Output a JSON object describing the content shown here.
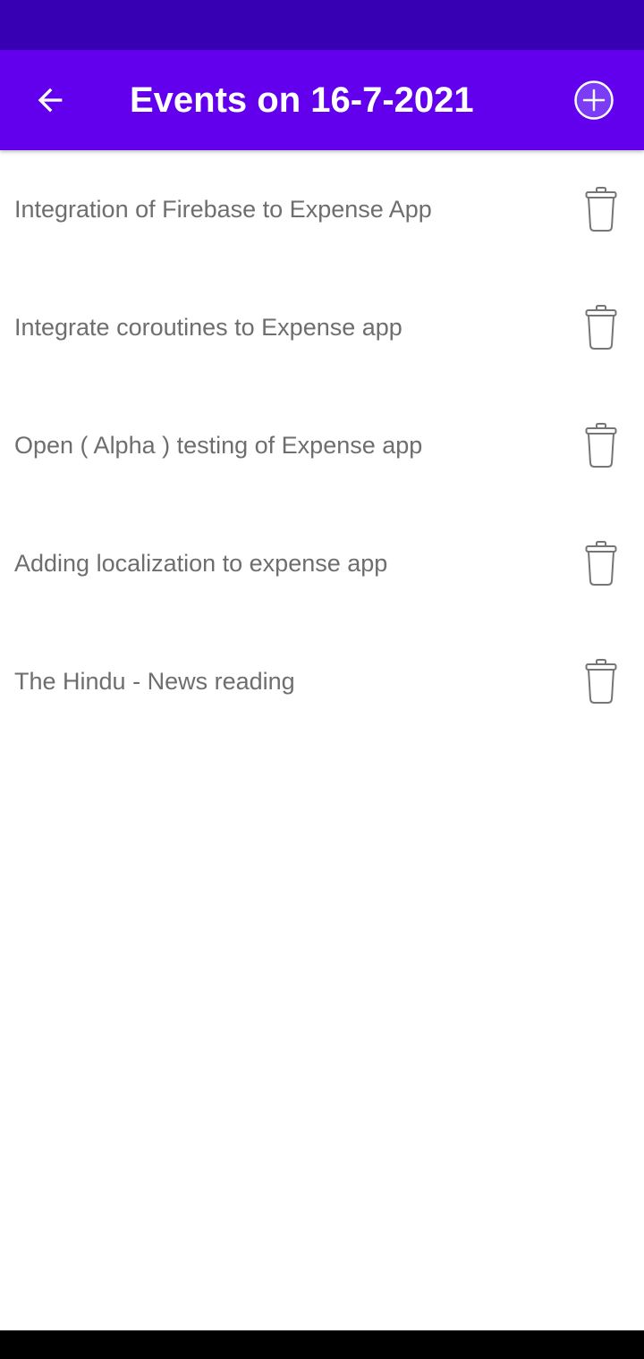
{
  "header": {
    "title": "Events on 16-7-2021",
    "back_icon": "arrow-left-icon",
    "add_icon": "plus-circle-icon"
  },
  "events": [
    {
      "label": "Integration of Firebase to Expense App",
      "icon": "trash-icon"
    },
    {
      "label": "Integrate coroutines to Expense app",
      "icon": "trash-icon"
    },
    {
      "label": "Open ( Alpha ) testing of Expense app",
      "icon": "trash-icon"
    },
    {
      "label": "Adding localization to expense app",
      "icon": "trash-icon"
    },
    {
      "label": "The Hindu - News reading",
      "icon": "trash-icon"
    }
  ],
  "colors": {
    "status_bar": "#3700b3",
    "app_bar": "#6200ee",
    "text": "#6e6e6e",
    "icon": "#757575"
  }
}
